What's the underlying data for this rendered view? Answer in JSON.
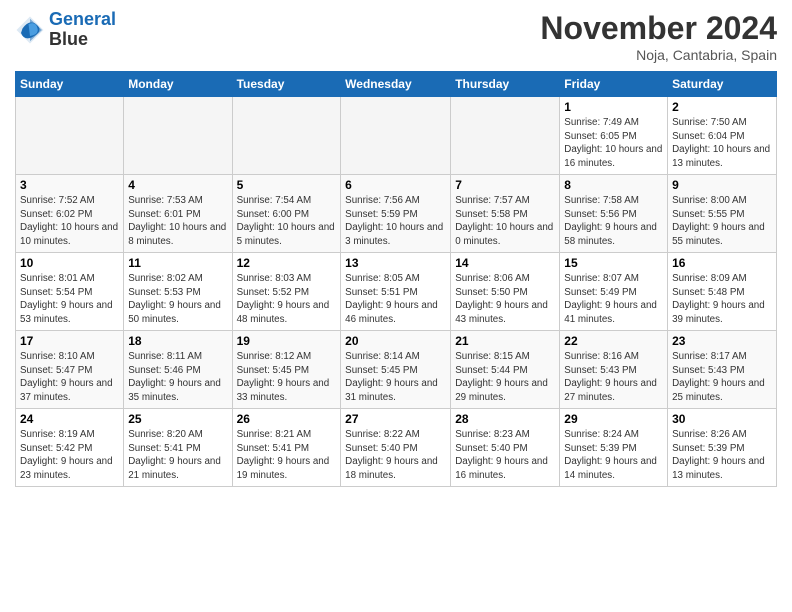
{
  "header": {
    "logo_line1": "General",
    "logo_line2": "Blue",
    "month_title": "November 2024",
    "location": "Noja, Cantabria, Spain"
  },
  "weekdays": [
    "Sunday",
    "Monday",
    "Tuesday",
    "Wednesday",
    "Thursday",
    "Friday",
    "Saturday"
  ],
  "weeks": [
    [
      {
        "day": "",
        "info": ""
      },
      {
        "day": "",
        "info": ""
      },
      {
        "day": "",
        "info": ""
      },
      {
        "day": "",
        "info": ""
      },
      {
        "day": "",
        "info": ""
      },
      {
        "day": "1",
        "info": "Sunrise: 7:49 AM\nSunset: 6:05 PM\nDaylight: 10 hours and 16 minutes."
      },
      {
        "day": "2",
        "info": "Sunrise: 7:50 AM\nSunset: 6:04 PM\nDaylight: 10 hours and 13 minutes."
      }
    ],
    [
      {
        "day": "3",
        "info": "Sunrise: 7:52 AM\nSunset: 6:02 PM\nDaylight: 10 hours and 10 minutes."
      },
      {
        "day": "4",
        "info": "Sunrise: 7:53 AM\nSunset: 6:01 PM\nDaylight: 10 hours and 8 minutes."
      },
      {
        "day": "5",
        "info": "Sunrise: 7:54 AM\nSunset: 6:00 PM\nDaylight: 10 hours and 5 minutes."
      },
      {
        "day": "6",
        "info": "Sunrise: 7:56 AM\nSunset: 5:59 PM\nDaylight: 10 hours and 3 minutes."
      },
      {
        "day": "7",
        "info": "Sunrise: 7:57 AM\nSunset: 5:58 PM\nDaylight: 10 hours and 0 minutes."
      },
      {
        "day": "8",
        "info": "Sunrise: 7:58 AM\nSunset: 5:56 PM\nDaylight: 9 hours and 58 minutes."
      },
      {
        "day": "9",
        "info": "Sunrise: 8:00 AM\nSunset: 5:55 PM\nDaylight: 9 hours and 55 minutes."
      }
    ],
    [
      {
        "day": "10",
        "info": "Sunrise: 8:01 AM\nSunset: 5:54 PM\nDaylight: 9 hours and 53 minutes."
      },
      {
        "day": "11",
        "info": "Sunrise: 8:02 AM\nSunset: 5:53 PM\nDaylight: 9 hours and 50 minutes."
      },
      {
        "day": "12",
        "info": "Sunrise: 8:03 AM\nSunset: 5:52 PM\nDaylight: 9 hours and 48 minutes."
      },
      {
        "day": "13",
        "info": "Sunrise: 8:05 AM\nSunset: 5:51 PM\nDaylight: 9 hours and 46 minutes."
      },
      {
        "day": "14",
        "info": "Sunrise: 8:06 AM\nSunset: 5:50 PM\nDaylight: 9 hours and 43 minutes."
      },
      {
        "day": "15",
        "info": "Sunrise: 8:07 AM\nSunset: 5:49 PM\nDaylight: 9 hours and 41 minutes."
      },
      {
        "day": "16",
        "info": "Sunrise: 8:09 AM\nSunset: 5:48 PM\nDaylight: 9 hours and 39 minutes."
      }
    ],
    [
      {
        "day": "17",
        "info": "Sunrise: 8:10 AM\nSunset: 5:47 PM\nDaylight: 9 hours and 37 minutes."
      },
      {
        "day": "18",
        "info": "Sunrise: 8:11 AM\nSunset: 5:46 PM\nDaylight: 9 hours and 35 minutes."
      },
      {
        "day": "19",
        "info": "Sunrise: 8:12 AM\nSunset: 5:45 PM\nDaylight: 9 hours and 33 minutes."
      },
      {
        "day": "20",
        "info": "Sunrise: 8:14 AM\nSunset: 5:45 PM\nDaylight: 9 hours and 31 minutes."
      },
      {
        "day": "21",
        "info": "Sunrise: 8:15 AM\nSunset: 5:44 PM\nDaylight: 9 hours and 29 minutes."
      },
      {
        "day": "22",
        "info": "Sunrise: 8:16 AM\nSunset: 5:43 PM\nDaylight: 9 hours and 27 minutes."
      },
      {
        "day": "23",
        "info": "Sunrise: 8:17 AM\nSunset: 5:43 PM\nDaylight: 9 hours and 25 minutes."
      }
    ],
    [
      {
        "day": "24",
        "info": "Sunrise: 8:19 AM\nSunset: 5:42 PM\nDaylight: 9 hours and 23 minutes."
      },
      {
        "day": "25",
        "info": "Sunrise: 8:20 AM\nSunset: 5:41 PM\nDaylight: 9 hours and 21 minutes."
      },
      {
        "day": "26",
        "info": "Sunrise: 8:21 AM\nSunset: 5:41 PM\nDaylight: 9 hours and 19 minutes."
      },
      {
        "day": "27",
        "info": "Sunrise: 8:22 AM\nSunset: 5:40 PM\nDaylight: 9 hours and 18 minutes."
      },
      {
        "day": "28",
        "info": "Sunrise: 8:23 AM\nSunset: 5:40 PM\nDaylight: 9 hours and 16 minutes."
      },
      {
        "day": "29",
        "info": "Sunrise: 8:24 AM\nSunset: 5:39 PM\nDaylight: 9 hours and 14 minutes."
      },
      {
        "day": "30",
        "info": "Sunrise: 8:26 AM\nSunset: 5:39 PM\nDaylight: 9 hours and 13 minutes."
      }
    ]
  ]
}
